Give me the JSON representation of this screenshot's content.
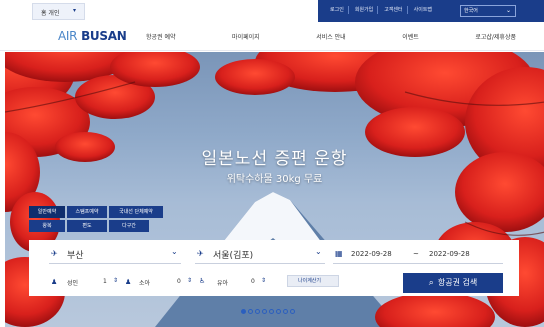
{
  "topbar": {
    "home_tab": {
      "label": "홈 개인",
      "chevron": "▾"
    },
    "utility_links": [
      "로그인",
      "회원가입",
      "고객센터",
      "사이트맵"
    ],
    "language": {
      "selected": "한국어",
      "chevron": "⌄"
    }
  },
  "nav": {
    "logo": {
      "prefix": "AIR",
      "name": "BUSAN"
    },
    "menu": [
      "항공권 예약",
      "마이페이지",
      "서비스 안내",
      "이벤트",
      "로고샵/제휴상품"
    ]
  },
  "hero": {
    "headline": "일본노선 증편 운항",
    "subline": "위탁수하물 30kg 무료"
  },
  "booking": {
    "tabs_row1": [
      "일반예약",
      "스탬프예약",
      "국내선 단체예약"
    ],
    "tabs_row2": [
      "왕복",
      "편도",
      "다구간"
    ],
    "active_tab": "일반예약",
    "departure": "부산",
    "arrival": "서울(김포)",
    "depart_date": "2022-09-28",
    "date_separator": "~",
    "return_date": "2022-09-28",
    "passengers": {
      "adult_label": "성인",
      "adult_count": "1",
      "child_label": "소아",
      "child_count": "0",
      "infant_label": "유아",
      "infant_count": "0"
    },
    "calculator_label": "나이계산기",
    "search_label": "항공권 검색"
  },
  "carousel": {
    "total": 8,
    "active_index": 0
  },
  "icons": {
    "depart": "plane-depart-icon",
    "arrive": "plane-arrive-icon",
    "calendar": "calendar-icon",
    "adult": "person-icon",
    "child": "child-icon",
    "infant": "stroller-icon",
    "search": "search-icon"
  },
  "colors": {
    "brand_navy": "#1a3d8a",
    "brand_blue": "#4a86c8",
    "leaf_red": "#d8201c",
    "mountain_snow": "#f4f7fb"
  }
}
